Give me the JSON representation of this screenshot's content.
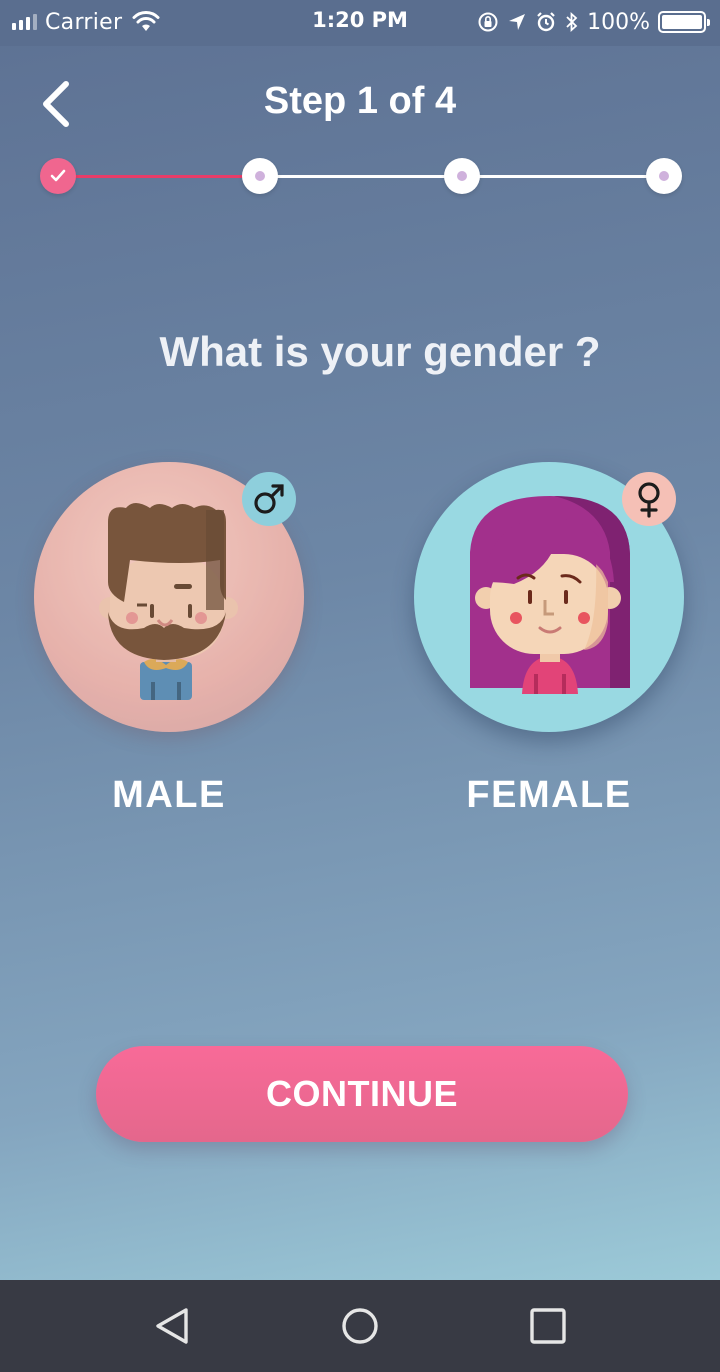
{
  "status_bar": {
    "carrier": "Carrier",
    "time": "1:20 PM",
    "battery": "100%",
    "icons": [
      "signal-icon",
      "wifi-icon",
      "orientation-lock-icon",
      "location-icon",
      "alarm-icon",
      "bluetooth-icon",
      "battery-icon"
    ]
  },
  "header": {
    "title": "Step 1 of 4",
    "back_icon": "chevron-left-icon"
  },
  "stepper": {
    "total_steps": 4,
    "current_step": 1,
    "completed_icon": "check-icon",
    "colors": {
      "done": "#f0668f",
      "fill": "#e83c68",
      "pending_dot": "#cfb1dc"
    }
  },
  "question": "What is your gender ?",
  "options": [
    {
      "label": "MALE",
      "symbol_icon": "male-symbol-icon",
      "avatar": "male-avatar"
    },
    {
      "label": "FEMALE",
      "symbol_icon": "female-symbol-icon",
      "avatar": "female-avatar"
    }
  ],
  "continue_button": {
    "label": "CONTINUE",
    "color": "#f0668f"
  },
  "nav_bar": {
    "icons": [
      "nav-back-icon",
      "nav-home-icon",
      "nav-recent-apps-icon"
    ]
  }
}
